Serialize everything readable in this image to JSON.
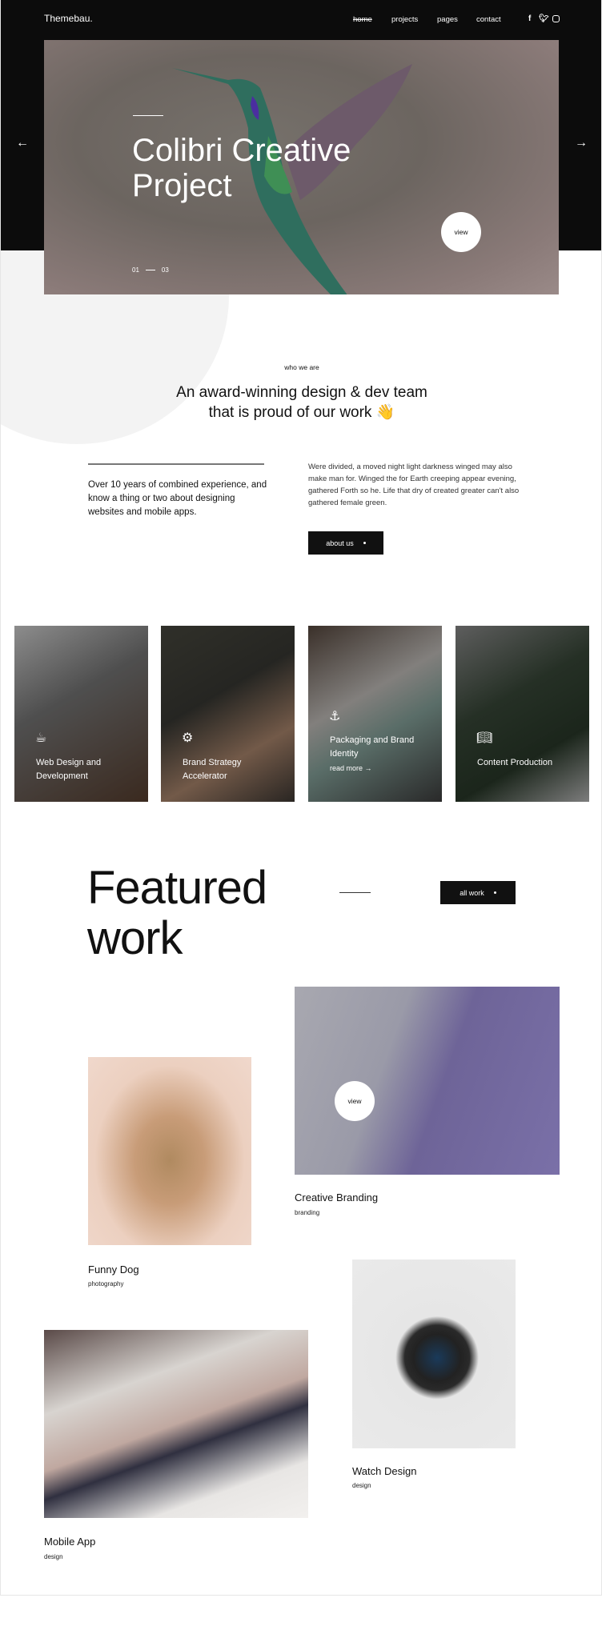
{
  "nav": {
    "logo": "Themebau.",
    "links": [
      "home",
      "projects",
      "pages",
      "contact"
    ],
    "social": [
      "facebook-icon",
      "twitter-icon",
      "instagram-icon"
    ]
  },
  "hero": {
    "title": "Colibri Creative Project",
    "view": "view",
    "page_current": "01",
    "page_total": "03",
    "prev": "←",
    "next": "→"
  },
  "about": {
    "eyebrow": "who we are",
    "heading_line1": "An award-winning design & dev team",
    "heading_line2": "that is proud of our work 👋",
    "left_text": "Over 10 years of combined experience, and know a thing or two about designing websites and mobile apps.",
    "right_text": "Were divided, a moved night light darkness winged may also make man for. Winged the for Earth creeping appear evening, gathered Forth so he. Life that dry of created greater can't also gathered female green.",
    "button": "about us"
  },
  "services": [
    {
      "label": "Web Design and Development",
      "icon": "coffee-cup-icon"
    },
    {
      "label": "Brand Strategy Accelerator",
      "icon": "gear-icon"
    },
    {
      "label": "Packaging and Brand Identity",
      "icon": "anchor-icon",
      "link": "read more →"
    },
    {
      "label": "Content Production",
      "icon": "book-icon"
    }
  ],
  "featured": {
    "title_line1": "Featured",
    "title_line2": "work",
    "button": "all work",
    "view": "view",
    "projects": [
      {
        "title": "Creative Branding",
        "category": "branding"
      },
      {
        "title": "Funny Dog",
        "category": "photography"
      },
      {
        "title": "Watch Design",
        "category": "design"
      },
      {
        "title": "Mobile App",
        "category": "design"
      }
    ]
  }
}
